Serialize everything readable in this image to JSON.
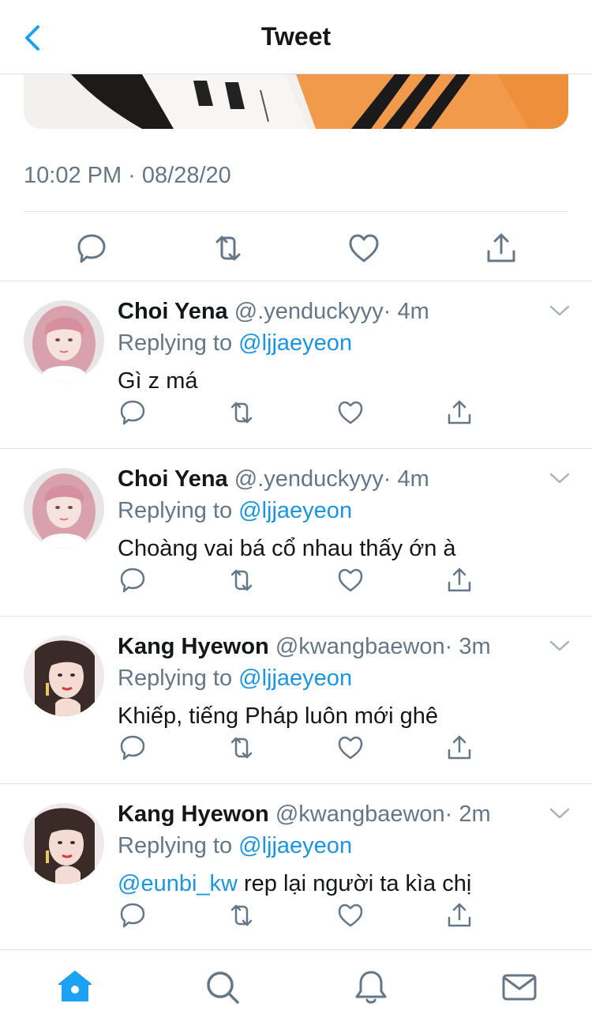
{
  "header": {
    "title": "Tweet",
    "back_icon": "chevron-left-icon"
  },
  "tweet": {
    "timestamp": "10:02 PM · 08/28/20",
    "actions": [
      "reply-icon",
      "retweet-icon",
      "like-icon",
      "share-icon"
    ]
  },
  "replies": [
    {
      "name": "Choi Yena",
      "handle": "@.yenduckyyy",
      "time": "· 4m",
      "replying_prefix": "Replying to ",
      "replying_to": "@ljjaeyeon",
      "text_mention": "",
      "text": "Gì z má"
    },
    {
      "name": "Choi Yena",
      "handle": "@.yenduckyyy",
      "time": "· 4m",
      "replying_prefix": "Replying to ",
      "replying_to": "@ljjaeyeon",
      "text_mention": "",
      "text": "Choàng vai bá cổ nhau thấy ớn à"
    },
    {
      "name": "Kang Hyewon",
      "handle": "@kwangbaewon",
      "time": "· 3m",
      "replying_prefix": "Replying to ",
      "replying_to": "@ljjaeyeon",
      "text_mention": "",
      "text": "Khiếp, tiếng Pháp luôn mới ghê"
    },
    {
      "name": "Kang Hyewon",
      "handle": "@kwangbaewon",
      "time": "· 2m",
      "replying_prefix": "Replying to ",
      "replying_to": "@ljjaeyeon",
      "text_mention": "@eunbi_kw",
      "text": " rep lại người ta kìa chị"
    }
  ],
  "tabbar": {
    "tabs": [
      "home-icon",
      "search-icon",
      "notifications-icon",
      "messages-icon"
    ],
    "active": "home-icon"
  },
  "colors": {
    "accent": "#1da1f2",
    "mention": "#1b95e0",
    "secondary": "#657786",
    "icon": "#657786",
    "divider": "#dfe3e6"
  }
}
